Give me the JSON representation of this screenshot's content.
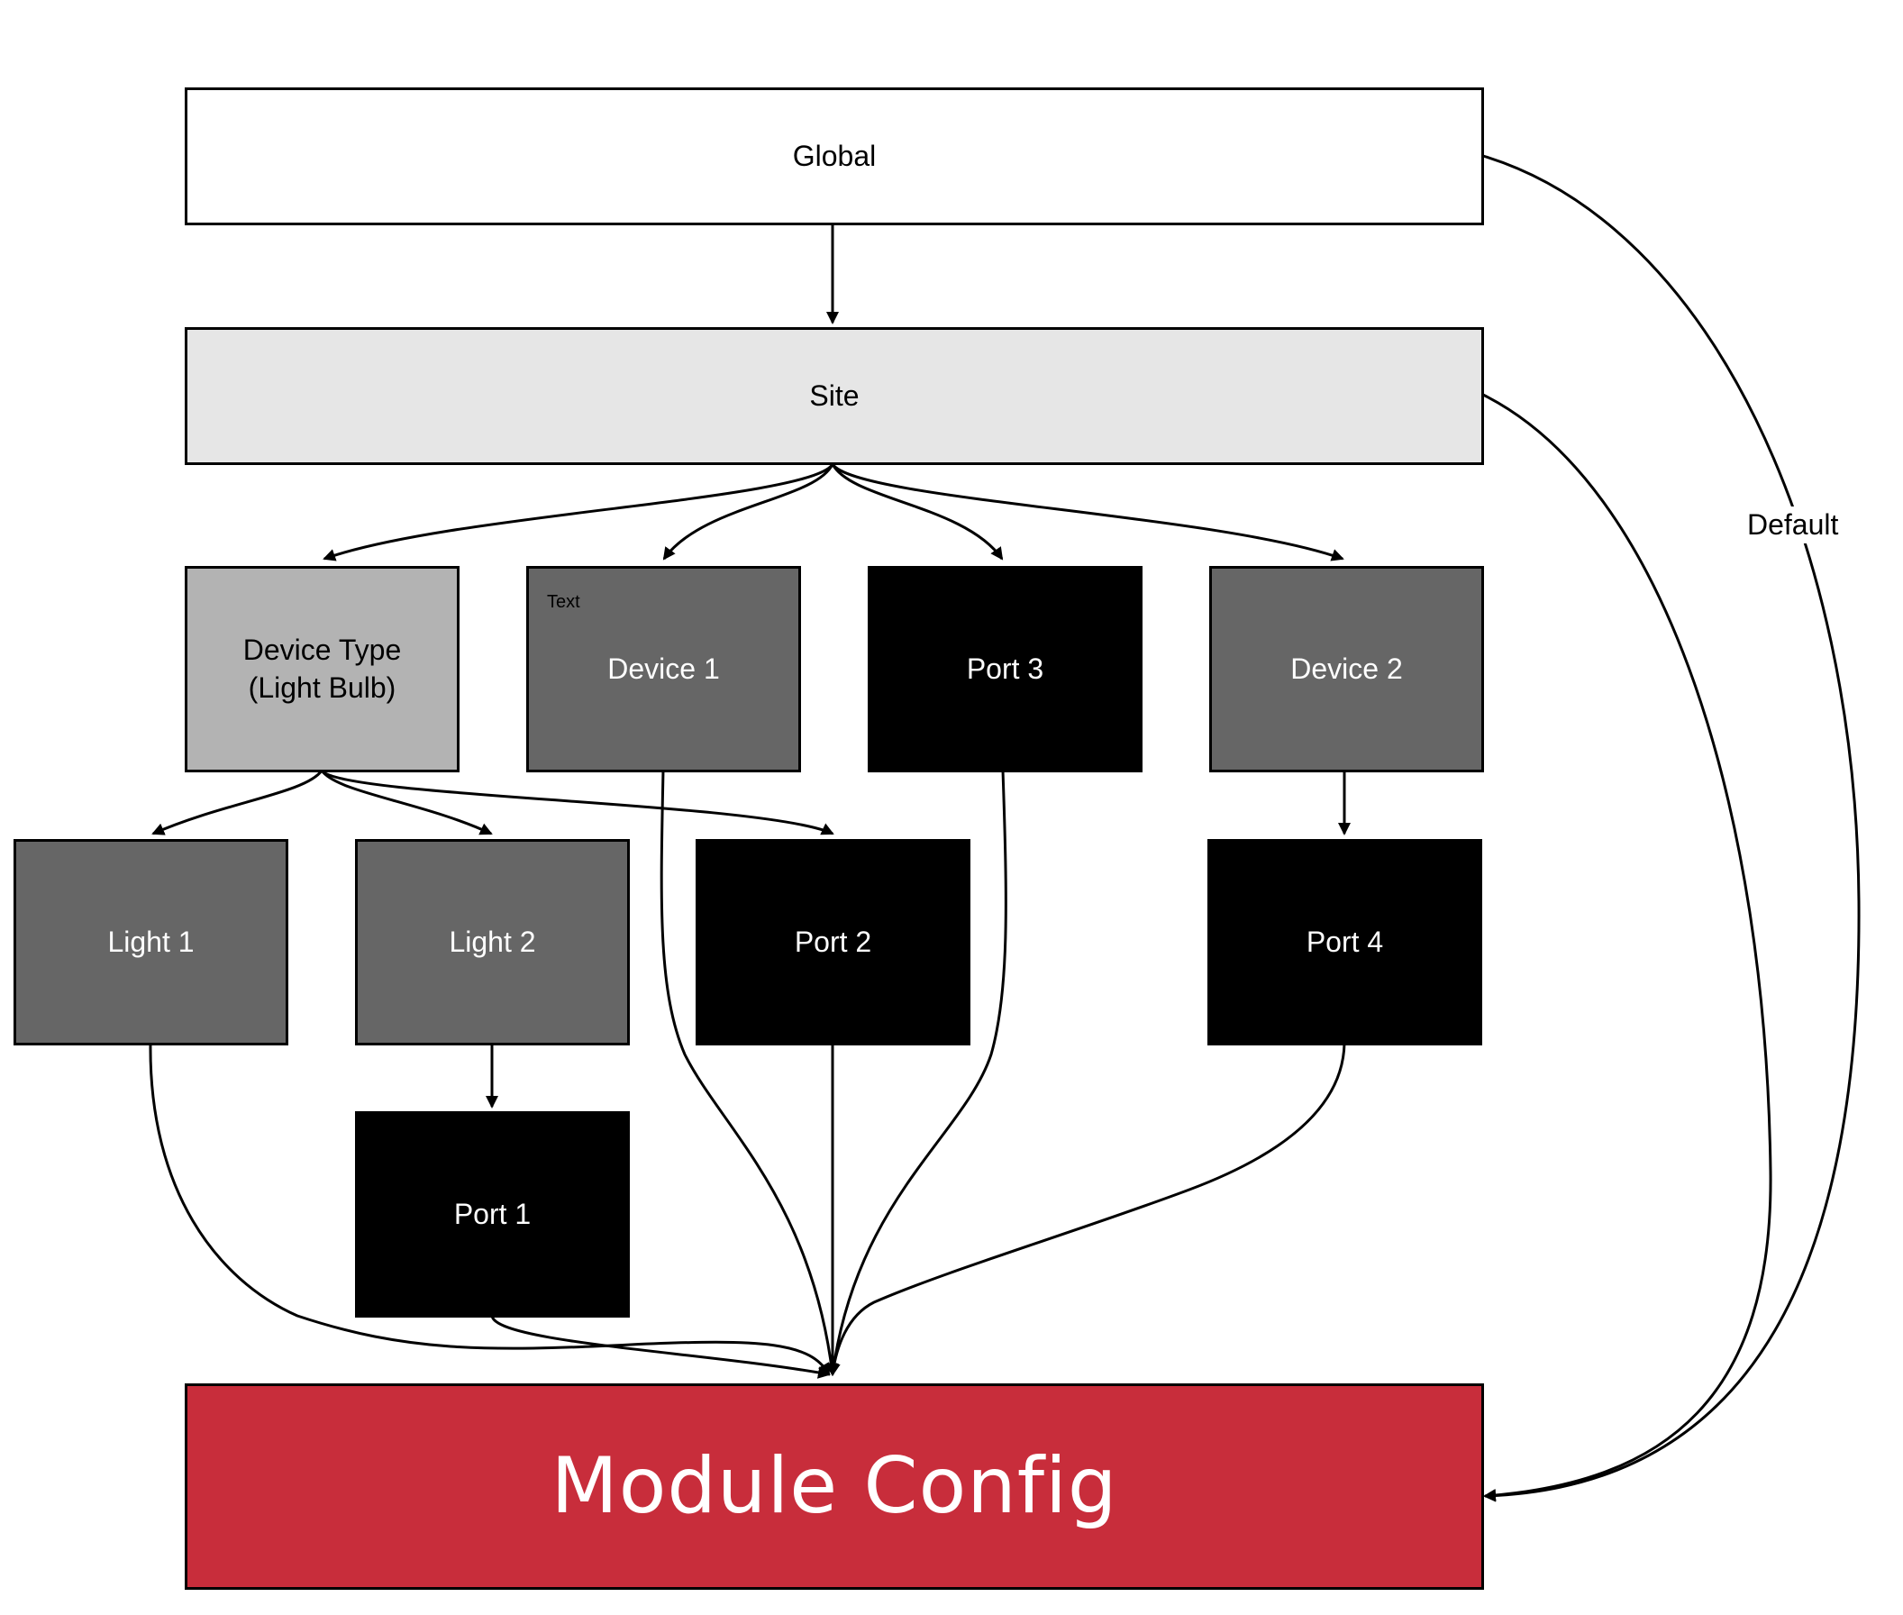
{
  "colors": {
    "white": "#ffffff",
    "site": "#e6e6e6",
    "device_type": "#b3b3b3",
    "device": "#666666",
    "port": "#000000",
    "module_config": "#c82d3b",
    "line": "#000000"
  },
  "nodes": {
    "global": {
      "label": "Global"
    },
    "site": {
      "label": "Site"
    },
    "device_type": {
      "label": "Device Type\n(Light Bulb)"
    },
    "device_1": {
      "label": "Device 1",
      "corner_label": "Text"
    },
    "port_3": {
      "label": "Port 3"
    },
    "device_2": {
      "label": "Device 2"
    },
    "light_1": {
      "label": "Light 1"
    },
    "light_2": {
      "label": "Light 2"
    },
    "port_2": {
      "label": "Port 2"
    },
    "port_4": {
      "label": "Port 4"
    },
    "port_1": {
      "label": "Port 1"
    },
    "module_config": {
      "label": "Module Config"
    }
  },
  "edges": {
    "default_label": "Default"
  }
}
